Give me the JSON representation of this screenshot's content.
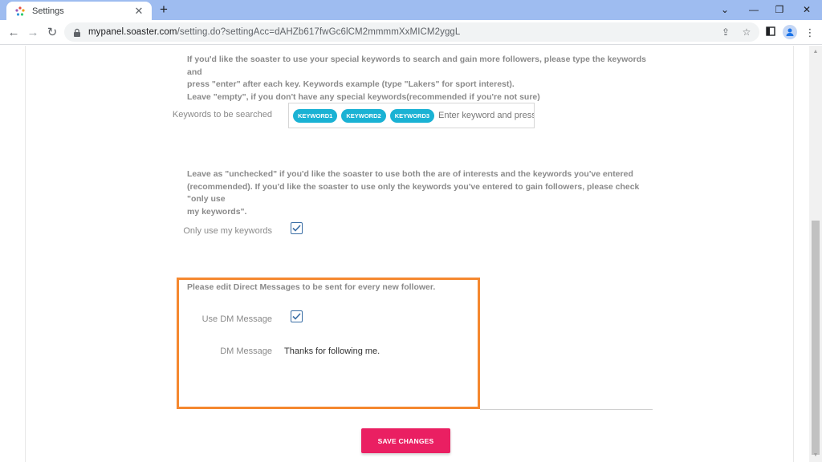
{
  "browser": {
    "tab_title": "Settings",
    "url_host": "mypanel.soaster.com",
    "url_rest": "/setting.do?settingAcc=dAHZb617fwGc6lCM2mmmmXxMICM2yggL"
  },
  "keywords_section": {
    "help_line1": "If you'd like the soaster to use your special keywords to search and gain more followers, please type the keywords and",
    "help_line2": "press \"enter\" after each key. Keywords example (type \"Lakers\" for sport interest).",
    "help_line3": "Leave \"empty\", if you don't have any special keywords(recommended if you're not sure)",
    "label": "Keywords to be searched",
    "chips": [
      "KEYWORD1",
      "KEYWORD2",
      "KEYWORD3"
    ],
    "input_placeholder": "Enter keyword and press enter"
  },
  "only_keywords_section": {
    "help_line1": "Leave as \"unchecked\" if you'd like the soaster to use both the are of interests and the keywords you've entered",
    "help_line2": "(recommended). If you'd like the soaster to use only the keywords you've entered to gain followers, please check \"only use",
    "help_line3": "my keywords\".",
    "label": "Only use my keywords",
    "checked": true
  },
  "dm_section": {
    "heading": "Please edit Direct Messages to be sent for every new follower.",
    "use_dm_label": "Use DM Message",
    "use_dm_checked": true,
    "dm_label": "DM Message",
    "dm_value": "Thanks for following me."
  },
  "save_button_label": "SAVE CHANGES",
  "colors": {
    "chip": "#1ab2d4",
    "save_button": "#ea1f62",
    "highlight": "#f5882f",
    "checkbox": "#3a6ea5"
  }
}
